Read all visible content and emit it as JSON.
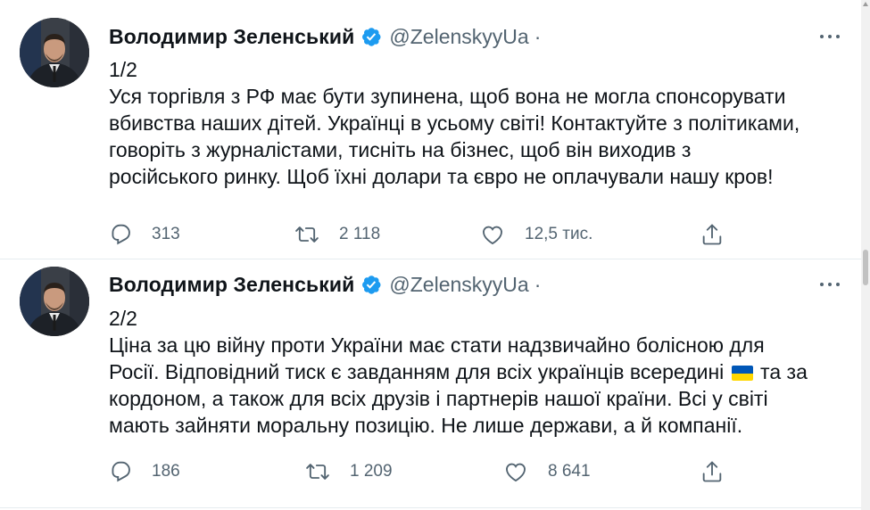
{
  "colors": {
    "verified": "#1d9bf0",
    "secondary_text": "#536471",
    "icon": "#536471",
    "flag_blue": "#0057b7",
    "flag_yellow": "#ffd700"
  },
  "tweets": [
    {
      "author_name": "Володимир Зеленський",
      "handle": "@ZelenskyyUa",
      "separator": "·",
      "counter": "1/2",
      "text": "Уся торгівля з РФ має бути зупинена, щоб вона не могла спонсорувати\nвбивства наших дітей. Українці в усьому світі! Контактуйте з політиками,\nговоріть з журналістами, тисніть на бізнес, щоб він виходив з\nросійського ринку. Щоб їхні долари та євро не оплачували нашу кров!",
      "replies": "313",
      "retweets": "2 118",
      "likes": "12,5 тис."
    },
    {
      "author_name": "Володимир Зеленський",
      "handle": "@ZelenskyyUa",
      "separator": "·",
      "counter": "2/2",
      "text_before_flag": "Ціна за цю війну проти України має стати надзвичайно болісною для\nРосії. Відповідний тиск є завданням для всіх українців всередині ",
      "text_after_flag": " та за\nкордоном, а також для всіх друзів і партнерів нашої країни. Всі у світі\nмають зайняти моральну позицію. Не лише держави, а й компанії.",
      "replies": "186",
      "retweets": "1 209",
      "likes": "8 641"
    }
  ],
  "icons": {
    "reply": "reply-icon",
    "retweet": "retweet-icon",
    "like": "heart-icon",
    "share": "share-icon",
    "more": "more-icon",
    "verified": "verified-badge-icon",
    "flag": "ukraine-flag-emoji"
  }
}
